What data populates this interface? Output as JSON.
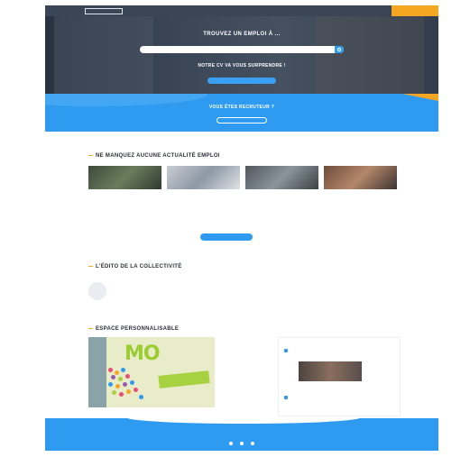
{
  "nav": {
    "logo": "",
    "links": [
      "",
      "",
      ""
    ],
    "login": "",
    "cta": ""
  },
  "hero": {
    "title": "TROUVEZ UN EMPLOI À ...",
    "subtitle": "",
    "search_placeholder": "",
    "filters": "",
    "title2": "NOTRE CV VA VOUS SURPRENDRE !",
    "subtitle2": "",
    "button": ""
  },
  "recruit": {
    "title": "VOUS ÊTES RECRUTEUR ?",
    "subtitle": "",
    "button": ""
  },
  "news": {
    "title": "NE MANQUEZ AUCUNE ACTUALITÉ EMPLOI",
    "cards": [
      {
        "title": "",
        "text": ""
      },
      {
        "title": "",
        "text": ""
      },
      {
        "title": "",
        "text": ""
      },
      {
        "title": "",
        "text": ""
      }
    ],
    "more_button": ""
  },
  "edito": {
    "title": "L'ÉDITO DE LA COLLECTIVITÉ",
    "name": "",
    "role": "",
    "paragraphs": [
      "",
      "",
      ""
    ]
  },
  "space": {
    "title": "ESPACE PERSONNALISABLE",
    "promo_logo": "MO",
    "promo_logo_sub": "",
    "promo_band": "",
    "tweets_head": "",
    "tweets": [
      {
        "name": "",
        "text": ""
      },
      {
        "name": "",
        "text": ""
      }
    ]
  },
  "footer": {
    "links": [
      "",
      "",
      ""
    ],
    "info": ""
  },
  "colors": {
    "primary_blue": "#2e9bf0",
    "accent_orange": "#f5a623",
    "dark_nav": "#3a4556"
  },
  "icons": [
    "search-icon",
    "twitter-icon",
    "facebook-icon",
    "linkedin-icon"
  ]
}
